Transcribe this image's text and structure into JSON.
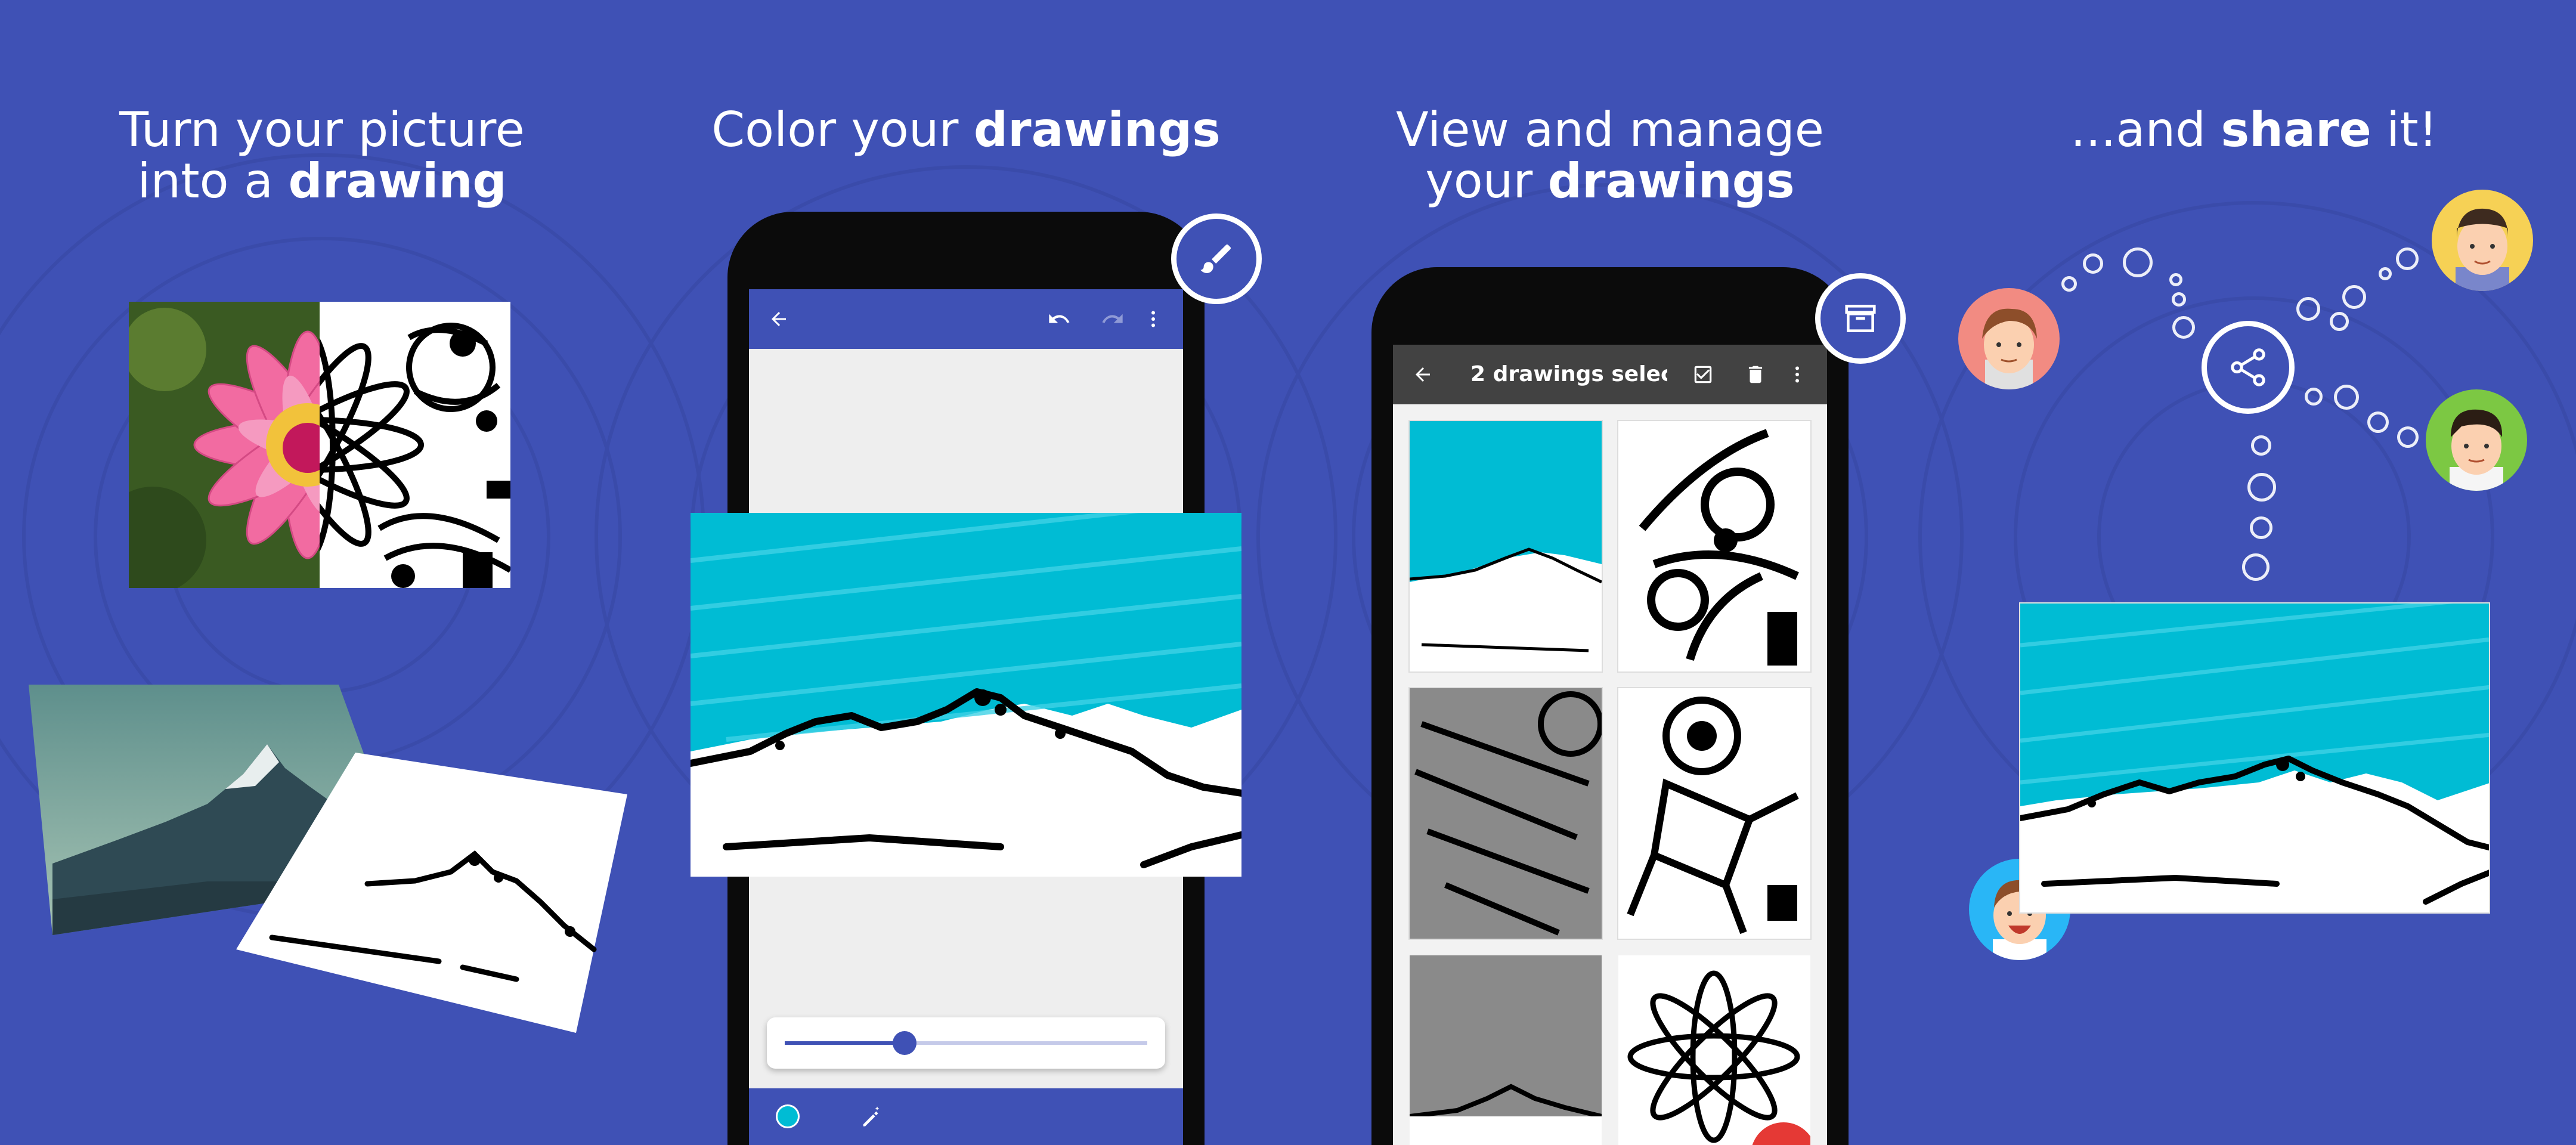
{
  "panels": [
    {
      "id": "turn",
      "heading_pre": "Turn your picture",
      "heading_mid": "into a ",
      "heading_bold": "drawing"
    },
    {
      "id": "color",
      "heading_pre": "Color your ",
      "heading_bold": "drawings"
    },
    {
      "id": "manage",
      "heading_pre": "View and manage",
      "heading_mid": "your ",
      "heading_bold": "drawings"
    },
    {
      "id": "share",
      "heading_pre": "...and ",
      "heading_bold": "share",
      "heading_post": " it!"
    }
  ],
  "manage_toolbar": {
    "title": "2 drawings selec..."
  },
  "color_editor": {
    "brush_size_fraction": 0.33
  },
  "icons": [
    "back-arrow-icon",
    "undo-icon",
    "redo-icon",
    "more-vert-icon",
    "brush-icon",
    "archive-icon",
    "checkbox-icon",
    "trash-icon",
    "share-icon",
    "color-dot-icon",
    "magic-pen-icon"
  ],
  "colors": {
    "background": "#3f51b5",
    "accent": "#00bcd4",
    "fab_red": "#e53935"
  }
}
